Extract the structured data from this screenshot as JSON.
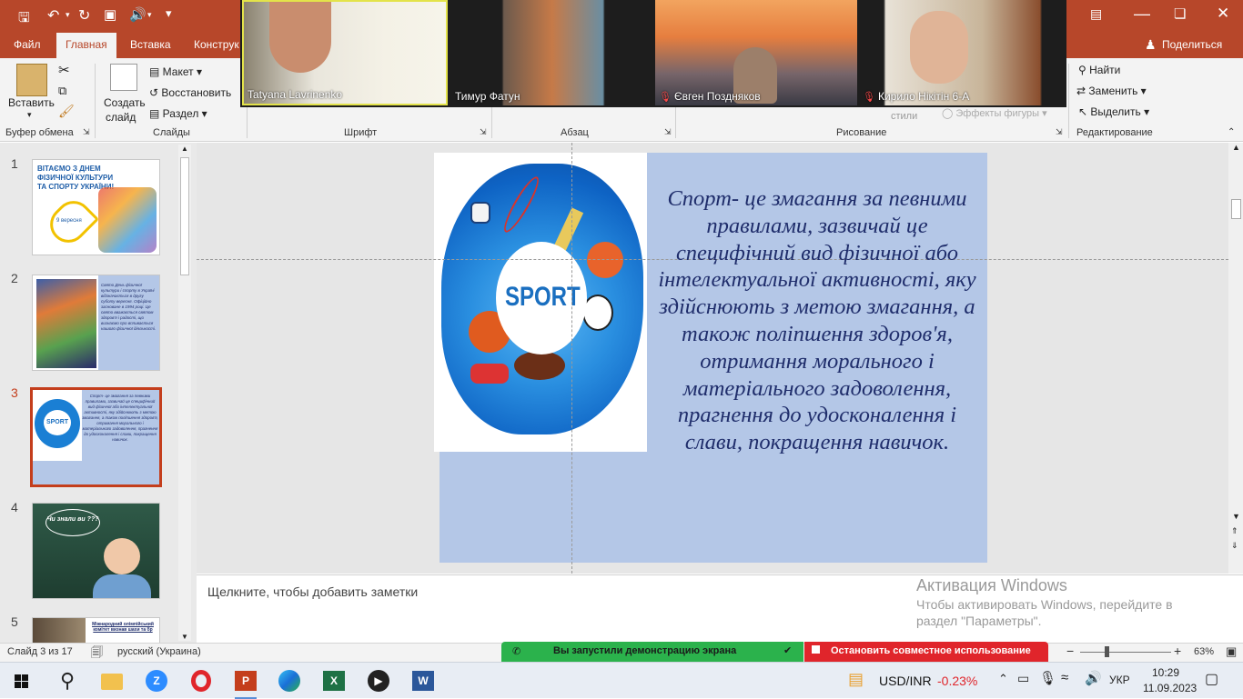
{
  "tabs": {
    "file": "Файл",
    "home": "Главная",
    "insert": "Вставка",
    "design": "Конструк"
  },
  "share_label": "Поделиться",
  "ribbon": {
    "paste": "Вставить",
    "new_slide": [
      "Создать",
      "слайд"
    ],
    "layout": "Макет",
    "reset": "Восстановить",
    "section": "Раздел",
    "groups": {
      "clipboard": "Буфер обмена",
      "slides": "Слайды",
      "font": "Шрифт",
      "paragraph": "Абзац",
      "drawing": "Рисование",
      "editing": "Редактирование"
    },
    "find": "Найти",
    "replace": "Заменить",
    "select": "Выделить",
    "styles": "стили",
    "shape_effects": "Эффекты фигуры"
  },
  "participants": [
    {
      "name": "Tatyana Lavrinenko",
      "muted": false
    },
    {
      "name": "Тимур Фатун",
      "muted": false
    },
    {
      "name": "Євген Поздняков",
      "muted": true
    },
    {
      "name": "Кирило Нікітін 6-А",
      "muted": true
    }
  ],
  "slides": [
    {
      "num": "1",
      "title": [
        "ВІТАЄМО З ДНЕМ",
        "ФІЗИЧНОЇ КУЛЬТУРИ",
        "ТА СПОРТУ УКРАЇНИ!"
      ],
      "date": "9 вересня"
    },
    {
      "num": "2",
      "text": "Свято День фізичної культури і спорту в Україні відзначається в другу суботу вересня. Офіційно засноване в 1994 році. Це свято вважається святом здоров'я і радості, що визнаємо про впливається нашого фізичної діяльності."
    },
    {
      "num": "3",
      "text": "Спорт- це змагання за певними правилами, зазвичай це специфічний вид фізичної або інтелектуальної активності, яку здійснюють з метою змагання, а також поліпшення здоров'я, отримання морального і матеріального задоволення, прагнення до удосконалення і слави, покращення навичок.",
      "thumb_label": "SPORT"
    },
    {
      "num": "4",
      "bubble": "Чи знали ви ???"
    },
    {
      "num": "5",
      "text": "Міжнародний олімпійський комітет визнав шахи та бр"
    }
  ],
  "main_slide": {
    "image_label": "SPORT",
    "text": "Спорт- це змагання за певними правилами, зазвичай це специфічний вид фізичної або інтелектуальної активності, яку здійснюють з метою змагання, а також поліпшення здоров'я, отримання морального і матеріального задоволення, прагнення до удосконалення і слави, покращення навичок.",
    "bg_color": "#b4c7e7",
    "text_color": "#1f2d6b"
  },
  "notes_placeholder": "Щелкните, чтобы добавить заметки",
  "watermark": {
    "title": "Активация Windows",
    "line1": "Чтобы активировать Windows, перейдите в",
    "line2": "раздел \"Параметры\"."
  },
  "status": {
    "slide_info": "Слайд 3 из 17",
    "language": "русский (Украина)",
    "share_notice": "Вы запустили демонстрацию экрана",
    "stop_share": "Остановить совместное использование",
    "zoom": "63%"
  },
  "taskbar": {
    "ticker": "USD/INR",
    "change": "-0.23%",
    "lang": "УКР",
    "time": "10:29",
    "date": "11.09.2023"
  },
  "colors": {
    "accent": "#b7472a",
    "share_green": "#2bb24c",
    "stop_red": "#e0252b",
    "negative": "#e0252b"
  }
}
